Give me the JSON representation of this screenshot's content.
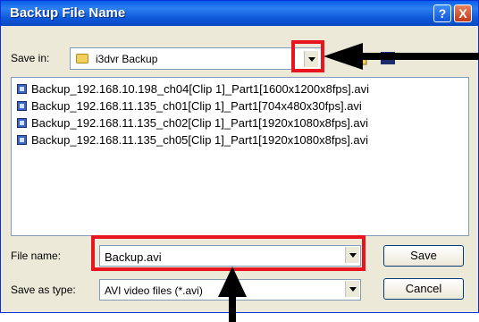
{
  "dialog": {
    "title": "Backup File Name",
    "help_glyph": "?",
    "close_glyph": "X"
  },
  "save_in": {
    "label": "Save in:",
    "value": "i3dvr Backup"
  },
  "files": [
    "Backup_192.168.10.198_ch04[Clip 1]_Part1[1600x1200x8fps].avi",
    "Backup_192.168.11.135_ch01[Clip 1]_Part1[704x480x30fps].avi",
    "Backup_192.168.11.135_ch02[Clip 1]_Part1[1920x1080x8fps].avi",
    "Backup_192.168.11.135_ch05[Clip 1]_Part1[1920x1080x8fps].avi"
  ],
  "file_name": {
    "label": "File name:",
    "value": "Backup.avi"
  },
  "save_as_type": {
    "label": "Save as type:",
    "value": "AVI video files (*.avi)"
  },
  "buttons": {
    "save": "Save",
    "cancel": "Cancel"
  },
  "colors": {
    "highlight": "#e8141e",
    "title_bar": "#0a5fe8"
  }
}
